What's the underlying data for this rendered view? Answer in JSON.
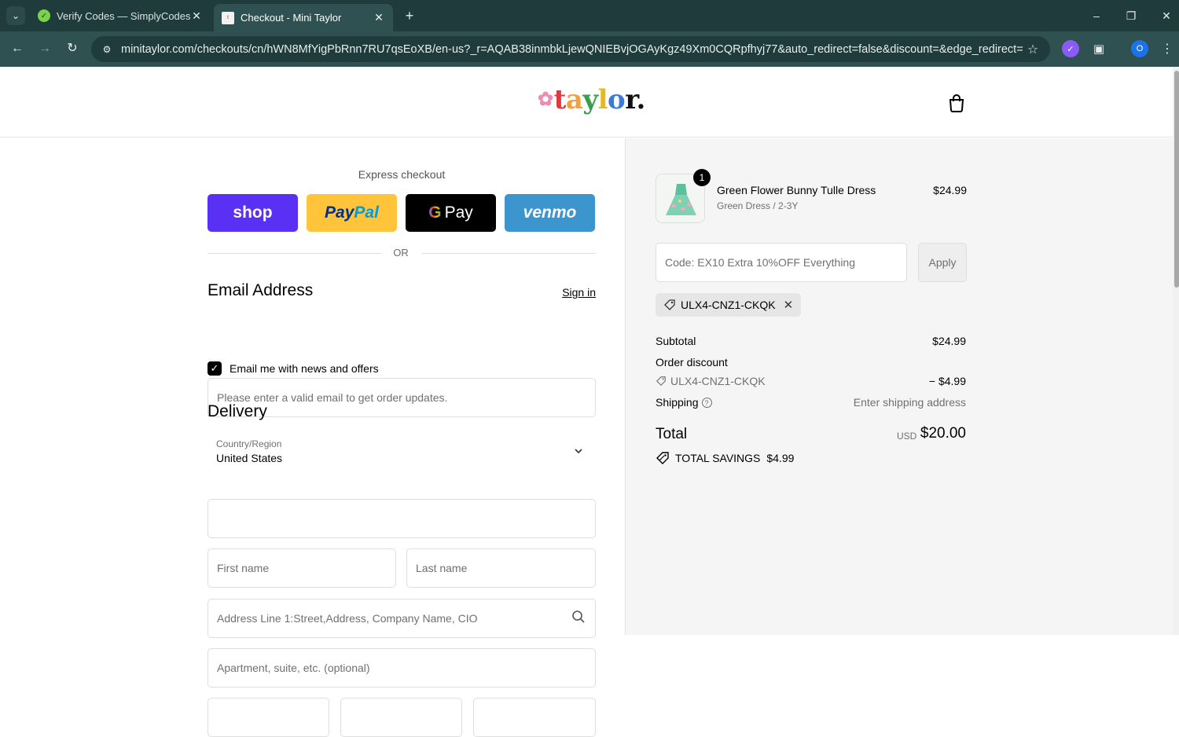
{
  "browser": {
    "tabs": [
      {
        "title": "Verify Codes — SimplyCodes",
        "active": false,
        "favicon": "simplycodes-icon"
      },
      {
        "title": "Checkout - Mini Taylor",
        "active": true,
        "favicon": "taylor-icon"
      }
    ],
    "url": "minitaylor.com/checkouts/cn/hWN8MfYigPbRnn7RU7qsEoXB/en-us?_r=AQAB38inmbkLjewQNIEBvjOGAyKgz49Xm0CQRpfhyj77&auto_redirect=false&discount=&edge_redirect=true&ski...",
    "profile_initial": "O"
  },
  "header": {
    "logo_text": "taylor."
  },
  "express": {
    "label": "Express checkout",
    "buttons": {
      "shop": "shop",
      "paypal_a": "Pay",
      "paypal_b": "Pal",
      "gpay_g": "G",
      "gpay": "Pay",
      "venmo": "venmo"
    },
    "or": "OR"
  },
  "contact": {
    "title": "Email Address",
    "sign_in": "Sign in",
    "email_placeholder": "Please enter a valid email to get order updates.",
    "newsletter_label": "Email me with news and offers",
    "newsletter_checked": true
  },
  "delivery": {
    "title": "Delivery",
    "country_label": "Country/Region",
    "country_value": "United States",
    "first_name_placeholder": "First name",
    "last_name_placeholder": "Last name",
    "address_placeholder": "Address Line 1:Street,Address, Company Name, CIO",
    "apartment_placeholder": "Apartment, suite, etc. (optional)"
  },
  "summary": {
    "product": {
      "name": "Green Flower Bunny Tulle Dress",
      "variant": "Green Dress / 2-3Y",
      "price": "$24.99",
      "quantity": "1"
    },
    "discount_placeholder": "Code: EX10 Extra 10%OFF Everything",
    "apply_label": "Apply",
    "applied_code": "ULX4-CNZ1-CKQK",
    "subtotal_label": "Subtotal",
    "subtotal_value": "$24.99",
    "order_discount_label": "Order discount",
    "order_discount_code": "ULX4-CNZ1-CKQK",
    "order_discount_value": "− $4.99",
    "shipping_label": "Shipping",
    "shipping_value": "Enter shipping address",
    "total_label": "Total",
    "total_currency": "USD",
    "total_value": "$20.00",
    "savings_label": "TOTAL SAVINGS",
    "savings_value": "$4.99"
  }
}
